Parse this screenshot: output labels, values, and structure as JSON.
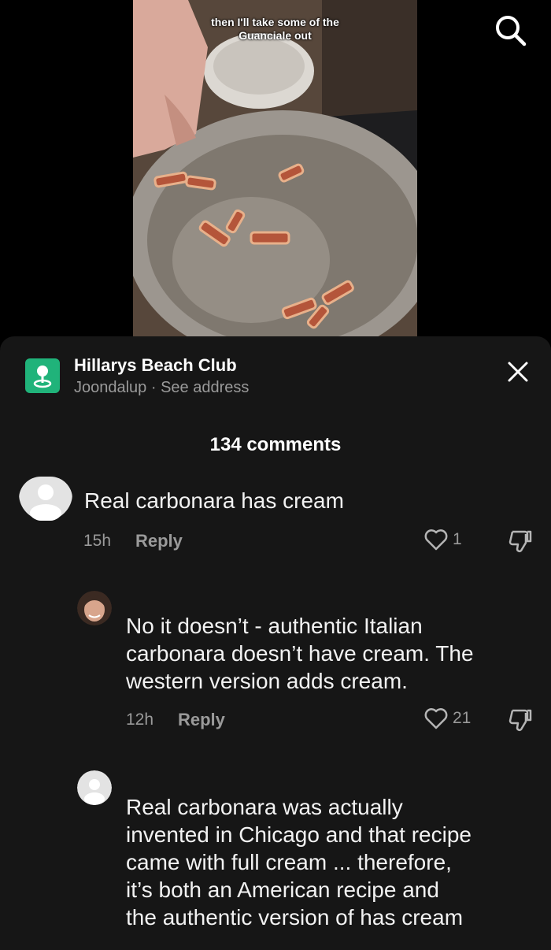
{
  "video": {
    "caption_line1": "then I'll take some of the",
    "caption_line2": "Guanciale out"
  },
  "icons": {
    "search": "search-icon",
    "location": "location-pin-icon",
    "close": "close-icon",
    "heart": "heart-icon",
    "dislike": "dislike-icon"
  },
  "location": {
    "name": "Hillarys Beach Club",
    "area": "Joondalup",
    "separator": " · ",
    "link": "See address"
  },
  "comments_header": "134 comments",
  "comments": [
    {
      "text": "Real carbonara has cream",
      "time": "15h",
      "reply": "Reply",
      "likes": "1"
    },
    {
      "lines": [
        "No it doesn’t - authentic Italian",
        "carbonara doesn’t have cream. The",
        "western version adds cream."
      ],
      "time": "12h",
      "reply": "Reply",
      "likes": "21"
    },
    {
      "lines": [
        "Real carbonara was actually",
        "invented in Chicago and that recipe",
        "came with full cream ... therefore,",
        "it’s both an American recipe and",
        "the authentic version of has cream"
      ]
    }
  ],
  "colors": {
    "sheet_bg": "#161616",
    "accent_green": "#20b37a",
    "muted_text": "#9a9a9a"
  }
}
